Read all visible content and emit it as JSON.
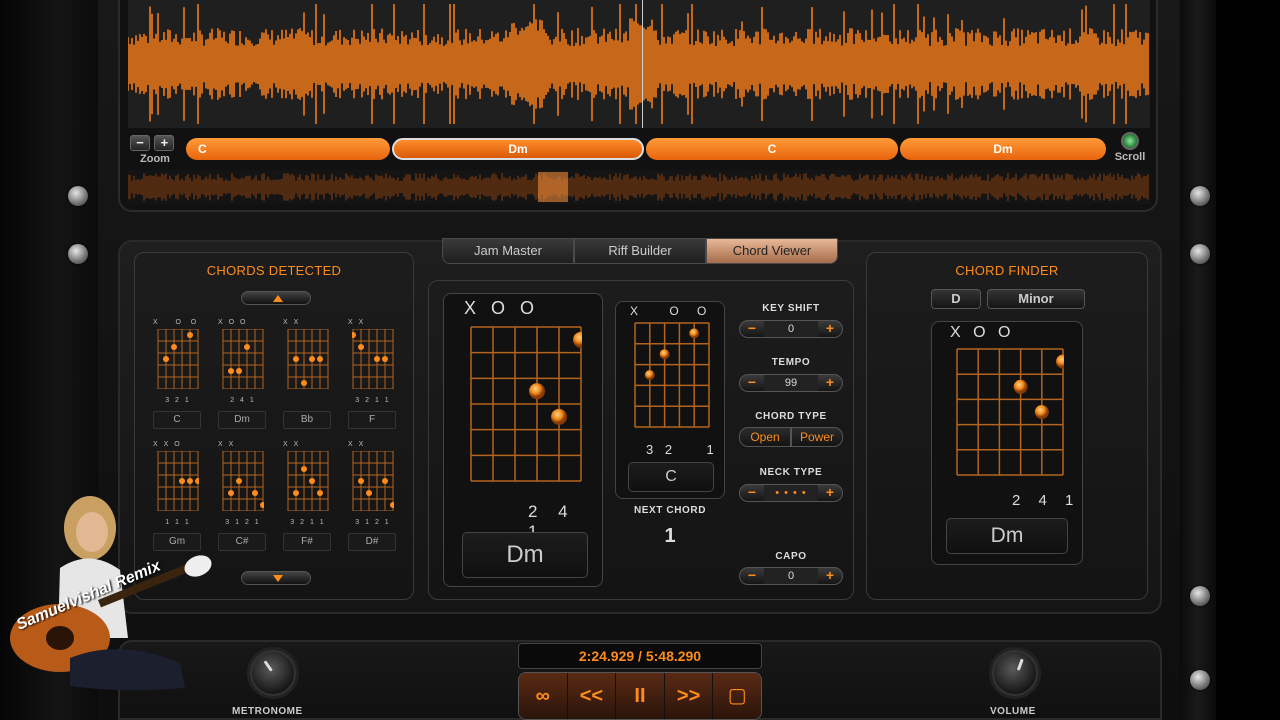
{
  "zoom": {
    "label": "Zoom",
    "minus": "−",
    "plus": "+"
  },
  "scroll": {
    "label": "Scroll"
  },
  "timeline": {
    "segments": [
      "C",
      "Dm",
      "C",
      "Dm"
    ],
    "active_index": 1
  },
  "tabs": [
    {
      "label": "Jam Master"
    },
    {
      "label": "Riff Builder"
    },
    {
      "label": "Chord Viewer"
    }
  ],
  "chords_detected": {
    "title": "CHORDS DETECTED",
    "chords": [
      {
        "name": "C",
        "marks": "X    O  O",
        "fingers": "3 2  1"
      },
      {
        "name": "Dm",
        "marks": "X O O",
        "fingers": "2 4 1"
      },
      {
        "name": "Bb",
        "marks": "X X",
        "fingers": ""
      },
      {
        "name": "F",
        "marks": "X X",
        "fingers": "3 2 1 1"
      },
      {
        "name": "Gm",
        "marks": "X X O",
        "fingers": "1 1 1"
      },
      {
        "name": "C#",
        "marks": "X X",
        "fingers": "3 1 2 1"
      },
      {
        "name": "F#",
        "marks": "X X",
        "fingers": "3 2 1 1"
      },
      {
        "name": "D#",
        "marks": "X X",
        "fingers": "3 1 2 1"
      }
    ]
  },
  "current_chord": {
    "marks": "X O O",
    "fingers": "2 4 1",
    "name": "Dm"
  },
  "next_chord": {
    "marks": "X       O    O",
    "fingers": "3 2    1",
    "name": "C",
    "label": "NEXT CHORD",
    "count": "1"
  },
  "controls": {
    "key_shift": {
      "label": "KEY SHIFT",
      "value": "0"
    },
    "tempo": {
      "label": "TEMPO",
      "value": "99"
    },
    "chord_type": {
      "label": "CHORD TYPE",
      "options": [
        "Open",
        "Power"
      ]
    },
    "neck_type": {
      "label": "NECK TYPE",
      "value": "• • • •"
    },
    "capo": {
      "label": "CAPO",
      "value": "0"
    },
    "minus": "−",
    "plus": "+"
  },
  "chord_finder": {
    "title": "CHORD FINDER",
    "root": "D",
    "quality": "Minor",
    "marks": "X O O",
    "fingers": "2 4 1",
    "name": "Dm"
  },
  "transport": {
    "time": "2:24.929 / 5:48.290",
    "buttons": [
      "∞",
      "<<",
      "II",
      ">>",
      "▢"
    ]
  },
  "metronome": {
    "label": "METRONOME"
  },
  "volume": {
    "label": "VOLUME"
  },
  "watermark": {
    "text": "Samuelvishal Remix"
  },
  "colors": {
    "accent": "#ff8c1a",
    "background": "#161616"
  }
}
